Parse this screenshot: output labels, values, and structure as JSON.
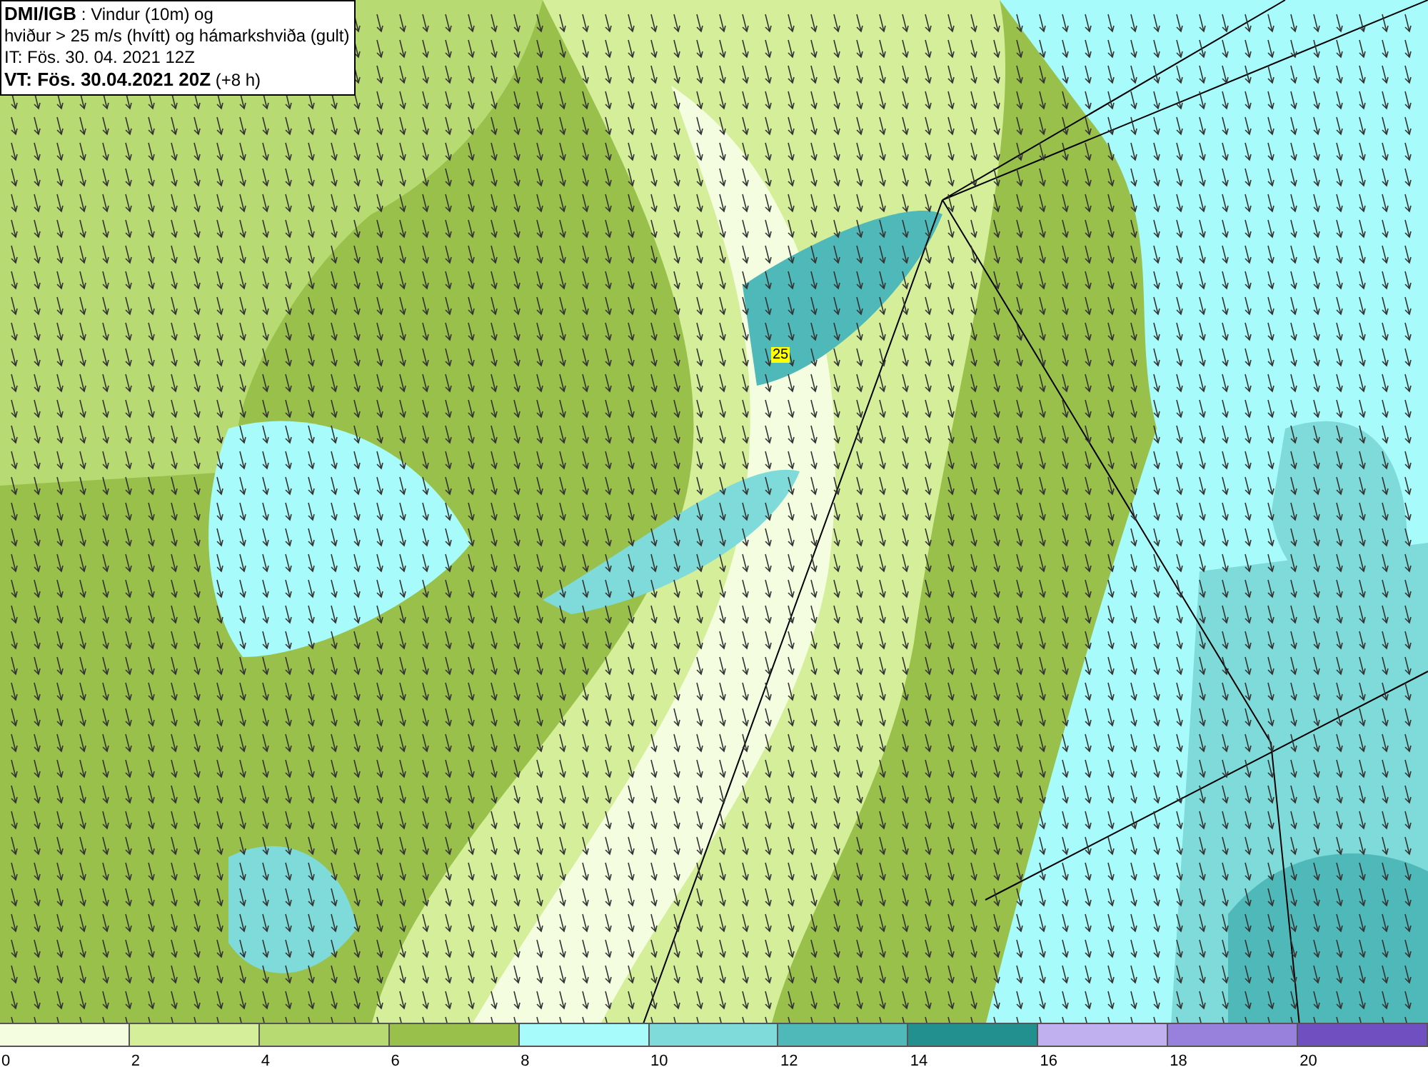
{
  "title_box": {
    "lines": [
      "**DMI/IGB** : Vindur (10m) og",
      "hviður > 25 m/s (hvítt) og hámarkshviða (gult)",
      "IT: Fös. 30. 04. 2021 12Z",
      "**VT: Fös. 30.04.2021 20Z** (+8 h)"
    ]
  },
  "map": {
    "gust_label": "25"
  },
  "legend": {
    "bins": [
      {
        "label": "0",
        "color": "#f5fde0"
      },
      {
        "label": "2",
        "color": "#d5ee9a"
      },
      {
        "label": "4",
        "color": "#b8da72"
      },
      {
        "label": "6",
        "color": "#98c04a"
      },
      {
        "label": "8",
        "color": "#a8fbfb"
      },
      {
        "label": "10",
        "color": "#7fdada"
      },
      {
        "label": "12",
        "color": "#4fb8b8"
      },
      {
        "label": "14",
        "color": "#239090"
      },
      {
        "label": "16",
        "color": "#c0b0f0"
      },
      {
        "label": "18",
        "color": "#9880dd"
      },
      {
        "label": "20",
        "color": "#7050c0"
      }
    ]
  }
}
